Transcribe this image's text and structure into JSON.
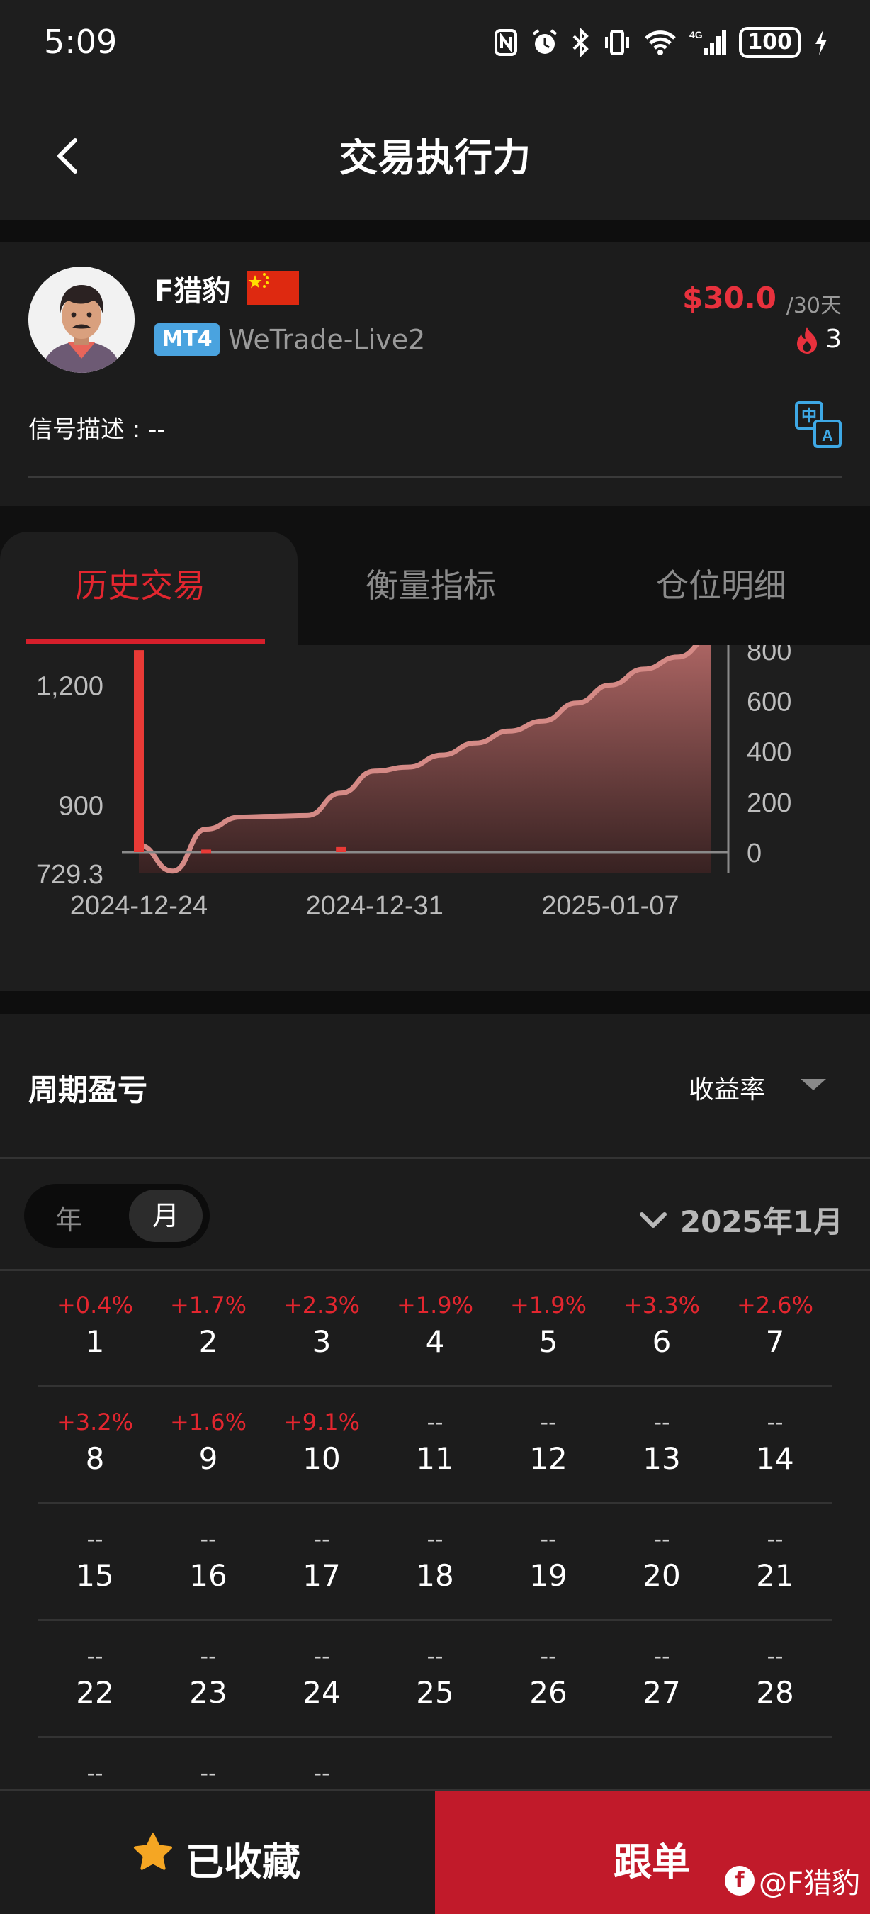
{
  "status_bar": {
    "time": "5:09",
    "icons": [
      "nfc-icon",
      "alarm-icon",
      "bluetooth-icon",
      "vibrate-icon",
      "wifi-icon",
      "signal-4g-icon",
      "battery-icon",
      "charging-icon"
    ],
    "network": "4G",
    "battery": "100"
  },
  "nav": {
    "title": "交易执行力",
    "back_icon": "chevron-left-icon"
  },
  "profile": {
    "name": "F猎豹",
    "platform": "MT4",
    "server": "WeTrade-Live2",
    "price": "$30.0",
    "period": "/30天",
    "fire_count": "3",
    "description": "信号描述 : --",
    "flag_color": "#de2910"
  },
  "tabs": [
    {
      "label": "历史交易",
      "active": true
    },
    {
      "label": "衡量指标",
      "active": false
    },
    {
      "label": "仓位明细",
      "active": false
    }
  ],
  "chart_data": {
    "type": "area",
    "x_ticks": [
      "2024-12-24",
      "2024-12-31",
      "2025-01-07"
    ],
    "y_left_ticks": [
      "1,200",
      "900",
      "729.3"
    ],
    "y_right_ticks": [
      "800",
      "600",
      "400",
      "200",
      "0"
    ],
    "x": [
      "2024-12-24",
      "2024-12-25",
      "2024-12-26",
      "2024-12-27",
      "2024-12-28",
      "2024-12-29",
      "2024-12-30",
      "2024-12-31",
      "2025-01-01",
      "2025-01-02",
      "2025-01-03",
      "2025-01-04",
      "2025-01-05",
      "2025-01-06",
      "2025-01-07",
      "2025-01-08",
      "2025-01-09",
      "2025-01-10"
    ],
    "equity": [
      800,
      735,
      840,
      870,
      872,
      874,
      930,
      985,
      995,
      1025,
      1055,
      1085,
      1110,
      1155,
      1200,
      1240,
      1270,
      1320
    ],
    "bars": [
      {
        "x": "2024-12-24",
        "value": 800
      },
      {
        "x": "2024-12-26",
        "value": 10
      },
      {
        "x": "2024-12-30",
        "value": 20
      }
    ],
    "y_left_range": [
      729.3,
      1300
    ],
    "y_right_range": [
      0,
      820
    ],
    "line_color": "#d58a86",
    "bar_color": "#e83a36"
  },
  "pnl": {
    "title": "周期盈亏",
    "metric": "收益率",
    "mode_year": "年",
    "mode_month": "月",
    "selected_mode": "月",
    "month": "2025年1月",
    "calendar": [
      [
        {
          "pct": "+0.4%",
          "day": "1"
        },
        {
          "pct": "+1.7%",
          "day": "2"
        },
        {
          "pct": "+2.3%",
          "day": "3"
        },
        {
          "pct": "+1.9%",
          "day": "4"
        },
        {
          "pct": "+1.9%",
          "day": "5"
        },
        {
          "pct": "+3.3%",
          "day": "6"
        },
        {
          "pct": "+2.6%",
          "day": "7"
        }
      ],
      [
        {
          "pct": "+3.2%",
          "day": "8"
        },
        {
          "pct": "+1.6%",
          "day": "9"
        },
        {
          "pct": "+9.1%",
          "day": "10"
        },
        {
          "pct": "--",
          "day": "11"
        },
        {
          "pct": "--",
          "day": "12"
        },
        {
          "pct": "--",
          "day": "13"
        },
        {
          "pct": "--",
          "day": "14"
        }
      ],
      [
        {
          "pct": "--",
          "day": "15"
        },
        {
          "pct": "--",
          "day": "16"
        },
        {
          "pct": "--",
          "day": "17"
        },
        {
          "pct": "--",
          "day": "18"
        },
        {
          "pct": "--",
          "day": "19"
        },
        {
          "pct": "--",
          "day": "20"
        },
        {
          "pct": "--",
          "day": "21"
        }
      ],
      [
        {
          "pct": "--",
          "day": "22"
        },
        {
          "pct": "--",
          "day": "23"
        },
        {
          "pct": "--",
          "day": "24"
        },
        {
          "pct": "--",
          "day": "25"
        },
        {
          "pct": "--",
          "day": "26"
        },
        {
          "pct": "--",
          "day": "27"
        },
        {
          "pct": "--",
          "day": "28"
        }
      ],
      [
        {
          "pct": "--",
          "day": ""
        },
        {
          "pct": "--",
          "day": ""
        },
        {
          "pct": "--",
          "day": ""
        }
      ]
    ]
  },
  "bottom": {
    "favorite_label": "已收藏",
    "follow_label": "跟单",
    "watermark": "@F猎豹",
    "accent": "#c11a2a",
    "star_color": "#f5a623"
  }
}
